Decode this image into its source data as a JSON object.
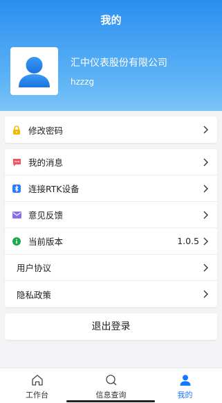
{
  "header": {
    "title": "我的",
    "company": "汇中仪表股份有限公司",
    "username": "hzzzg"
  },
  "menu_security": [
    {
      "label": "修改密码",
      "icon": "lock-icon",
      "color": "#f5b800"
    }
  ],
  "menu_main": [
    {
      "label": "我的消息",
      "icon": "message-icon",
      "color": "#f2555a"
    },
    {
      "label": "连接RTK设备",
      "icon": "bluetooth-icon",
      "color": "#2f7bf5"
    },
    {
      "label": "意见反馈",
      "icon": "mail-icon",
      "color": "#8a6cf0"
    },
    {
      "label": "当前版本",
      "icon": "info-icon",
      "color": "#1fa84f",
      "value": "1.0.5"
    },
    {
      "label": "用户协议"
    },
    {
      "label": "隐私政策"
    }
  ],
  "logout_label": "退出登录",
  "tabs": [
    {
      "label": "工作台",
      "icon": "home-icon",
      "active": false
    },
    {
      "label": "信息查询",
      "icon": "search-icon",
      "active": false
    },
    {
      "label": "我的",
      "icon": "person-icon",
      "active": true
    }
  ],
  "colors": {
    "accent": "#1677ff",
    "header_top": "#2b8ff0",
    "header_bottom": "#7cc4f6"
  }
}
